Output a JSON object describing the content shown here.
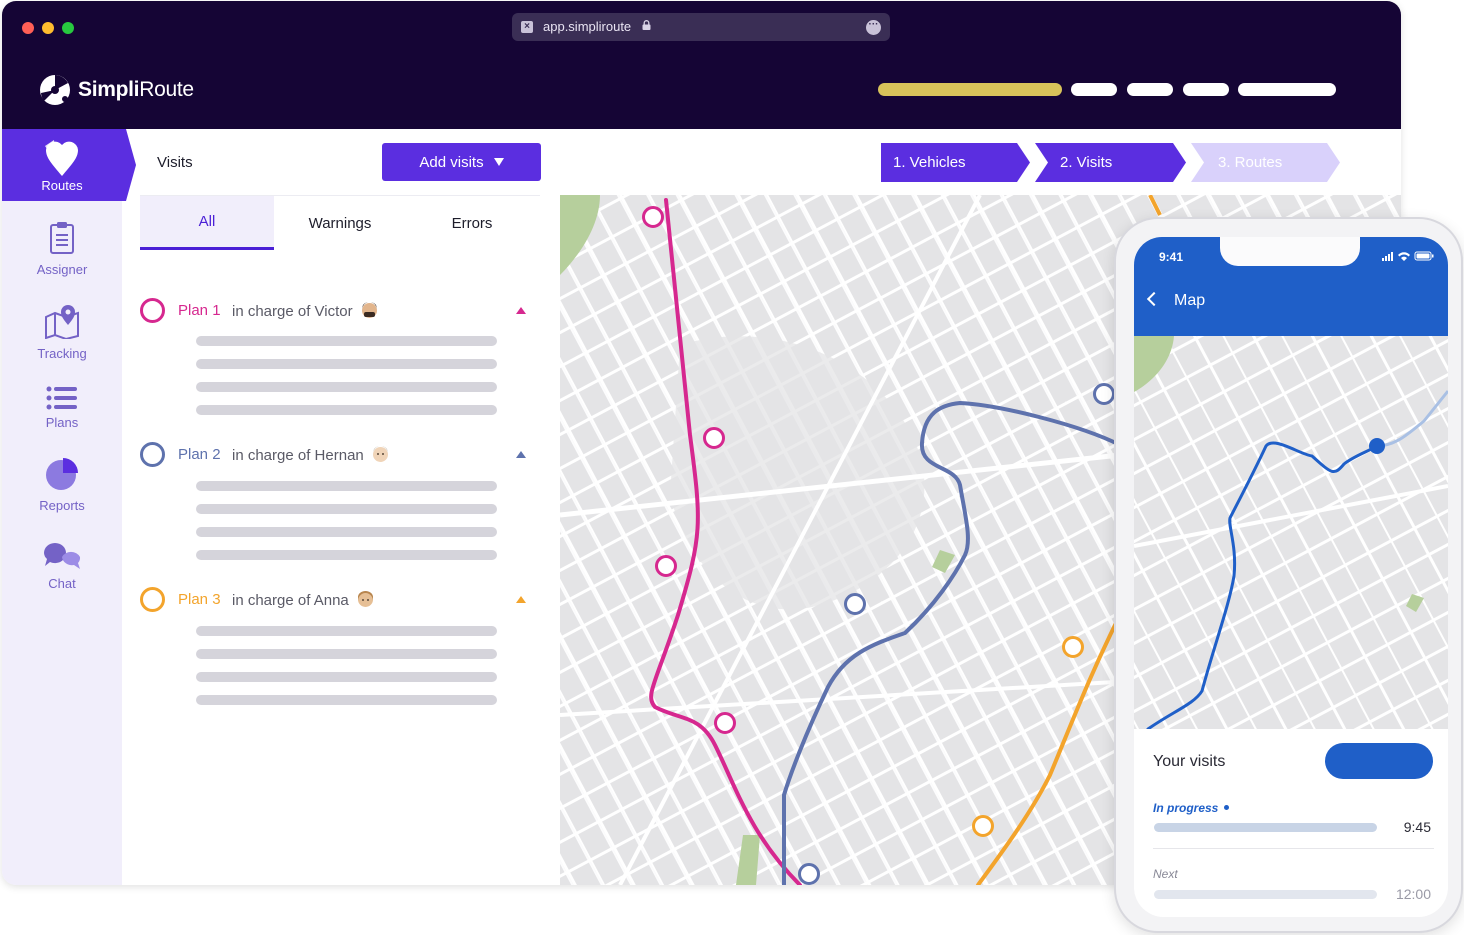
{
  "browser": {
    "url": "app.simpliroute"
  },
  "brand": {
    "name_bold": "Simpli",
    "name_light": "Route"
  },
  "sidebar": {
    "items": [
      {
        "label": "Routes",
        "icon": "map-pin-heart-icon",
        "active": true
      },
      {
        "label": "Assigner",
        "icon": "clipboard-icon"
      },
      {
        "label": "Tracking",
        "icon": "map-tracking-icon"
      },
      {
        "label": "Plans",
        "icon": "list-icon"
      },
      {
        "label": "Reports",
        "icon": "pie-chart-icon"
      },
      {
        "label": "Chat",
        "icon": "chat-bubbles-icon"
      }
    ]
  },
  "panel": {
    "title": "Visits",
    "add_button": "Add visits",
    "tabs": [
      "All",
      "Warnings",
      "Errors"
    ],
    "active_tab": "All"
  },
  "plans": [
    {
      "name": "Plan 1",
      "desc": "in charge of Victor",
      "color": "#d6288f"
    },
    {
      "name": "Plan 2",
      "desc": "in charge of Hernan",
      "color": "#5e72ad"
    },
    {
      "name": "Plan 3",
      "desc": "in charge of Anna",
      "color": "#f3a42c"
    }
  ],
  "steps": [
    {
      "label": "1. Vehicles",
      "state": "done"
    },
    {
      "label": "2. Visits",
      "state": "active"
    },
    {
      "label": "3. Routes",
      "state": "pending"
    }
  ],
  "colors": {
    "header_bg": "#150535",
    "primary": "#5b2ee0",
    "highlight_bar": "#d8c35a",
    "phone_blue": "#1f5fc8"
  },
  "phone": {
    "time": "9:41",
    "title": "Map",
    "visits_title": "Your visits",
    "in_progress": "In progress",
    "in_progress_time": "9:45",
    "next": "Next",
    "next_time": "12:00"
  }
}
